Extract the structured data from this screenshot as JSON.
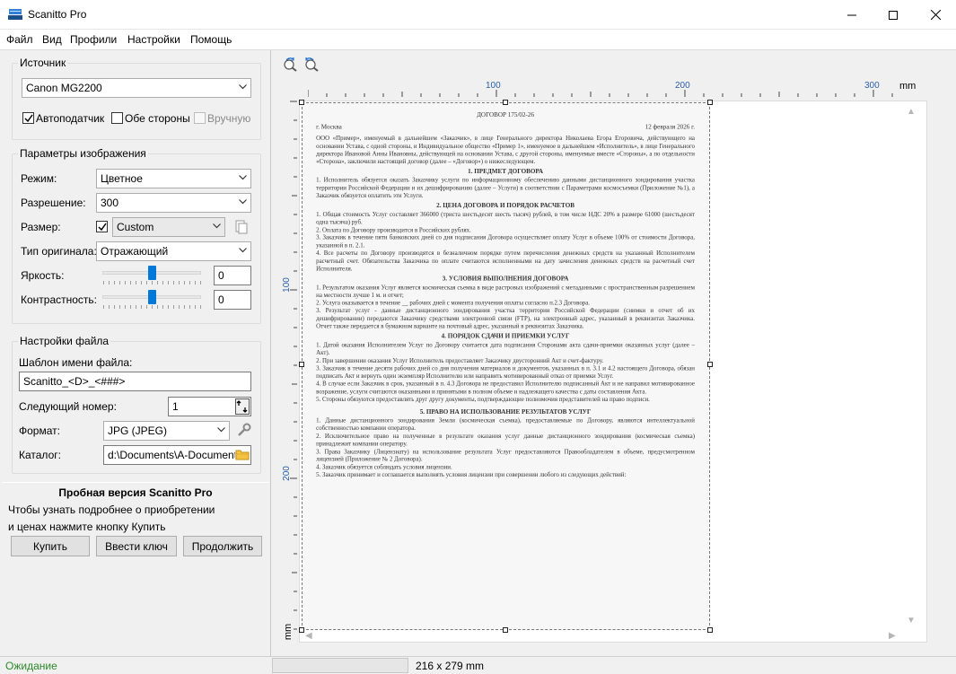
{
  "window": {
    "title": "Scanitto Pro",
    "min_label": "—",
    "max_label": "☐",
    "close_label": "✕"
  },
  "menu": [
    "Файл",
    "Вид",
    "Профили",
    "Настройки",
    "Помощь"
  ],
  "source": {
    "group_title": "Источник",
    "device": "Canon MG2200",
    "adf_label": "Автоподатчик",
    "adf_checked": true,
    "duplex_label": "Обе стороны",
    "duplex_checked": false,
    "manual_label": "Вручную",
    "manual_checked": false
  },
  "image_params": {
    "group_title": "Параметры изображения",
    "mode_label": "Режим:",
    "mode_value": "Цветное",
    "resolution_label": "Разрешение:",
    "resolution_value": "300",
    "size_label": "Размер:",
    "size_checked": true,
    "size_value": "Custom",
    "original_label": "Тип оригинала:",
    "original_value": "Отражающий",
    "brightness_label": "Яркость:",
    "brightness_value": "0",
    "contrast_label": "Контрастность:",
    "contrast_value": "0"
  },
  "file_settings": {
    "group_title": "Настройки файла",
    "template_label": "Шаблон имени файла:",
    "template_value": "Scanitto_<D>_<###>",
    "next_label": "Следующий номер:",
    "next_value": "1",
    "format_label": "Формат:",
    "format_value": "JPG (JPEG)",
    "folder_label": "Каталог:",
    "folder_value": "d:\\Documents\\A-Documents"
  },
  "trial": {
    "title": "Пробная версия Scanitto Pro",
    "line1": "Чтобы узнать подробнее о приобретении",
    "line2": "и ценах нажмите кнопку Купить",
    "buy": "Купить",
    "enter_key": "Ввести ключ",
    "continue": "Продолжить"
  },
  "ruler": {
    "unit": "mm",
    "top_ticks": [
      "100",
      "200",
      "300"
    ],
    "left_ticks": [
      "100",
      "200"
    ],
    "left_unit": "mm"
  },
  "status": {
    "state": "Ожидание",
    "state_color": "#2a8a2a",
    "size": "216 x 279 mm"
  },
  "document": {
    "title": "ДОГОВОР 175/02-26",
    "city": "г. Москва",
    "date": "12 февраля 2026 г.",
    "intro": "ООО «Пример», именуемый в дальнейшем «Заказчик», в лице Генерального директора Николаева Егора Егоровича, действующего на основании Устава, с одной стороны, и Индивидуальное общество «Пример 1», именуемое в дальнейшем «Исполнитель», в лице Генерального директора Ивановой Анны Ивановны, действующей на основании Устава, с другой стороны, именуемые вместе «Стороны», а по отдельности «Сторона», заключили настоящий договор (далее – «Договор») о нижеследующем.",
    "s1": "1. ПРЕДМЕТ ДОГОВОРА",
    "s1_1": "1. Исполнитель обязуется оказать Заказчику услуги по информационному обеспечению данными дистанционного зондирования участка территории Российской Федерации и их дешифрированию (далее – Услуги) в соответствии с Параметрами космосъемки (Приложение №1), а Заказчик обязуется оплатить эти Услуги.",
    "s2": "2. ЦЕНА ДОГОВОРА И ПОРЯДОК РАСЧЕТОВ",
    "s2_1": "1. Общая стоимость Услуг составляет 366000 (триста шестьдесят шесть тысяч) рублей, в том числе НДС 20% в размере 61000 (шестьдесят одна тысяча) руб.",
    "s2_2": "2. Оплата по Договору производится в Российских рублях.",
    "s2_3": "3. Заказчик в течение пяти банковских дней со дня подписания Договора осуществляет оплату Услуг в объеме 100% от стоимости Договора, указанной в п. 2.1.",
    "s2_4": "4. Все расчеты по Договору производятся в безналичном порядке путем перечисления денежных средств на указанный Исполнителем расчетный счет. Обязательства Заказчика по оплате считаются исполненными на дату зачисления денежных средств на расчетный счет Исполнителя.",
    "s3": "3. УСЛОВИЯ ВЫПОЛНЕНИЯ ДОГОВОРА",
    "s3_1": "1. Результатом оказания Услуг является космическая съемка в виде растровых изображений с метаданными с пространственным разрешением на местности лучше 1 м. и отчет;",
    "s3_2": "2. Услуга оказывается в течение __ рабочих дней с момента получения оплаты согласно п.2.3 Договора.",
    "s3_3": "3. Результат услуг - данные дистанционного зондирования участка территории Российской Федерации (снимки и отчет об их дешифрировании) передаются Заказчику средствами электронной связи (FTP), на электронный адрес, указанный в реквизитах Заказчика. Отчет также передается в бумажном варианте на почтовый адрес, указанный в реквизитах Заказчика.",
    "s4": "4. ПОРЯДОК СДАЧИ И ПРИЕМКИ УСЛУГ",
    "s4_1": "1. Датой оказания Исполнителем Услуг по Договору считается дата подписания Сторонами акта сдачи-приемки оказанных услуг (далее – Акт).",
    "s4_2": "2. При завершении оказания Услуг Исполнитель предоставляет Заказчику двусторонний Акт и счет-фактуру.",
    "s4_3": "3. Заказчик в течение десяти рабочих дней со дня получения материалов и документов, указанных в п. 3.1 и 4.2 настоящего Договора, обязан подписать Акт и вернуть один экземпляр Исполнителю или направить мотивированный отказ от приемки Услуг.",
    "s4_4": "4. В случае если Заказчик в срок, указанный в п. 4.3 Договора не предоставил Исполнителю подписанный Акт и не направил мотивированное возражение, услуги считаются оказанными и принятыми в полном объеме и надлежащего качества с даты составления Акта.",
    "s4_5": "5. Стороны обязуются предоставлять друг другу документы, подтверждающие полномочия представителей на право подписи.",
    "s5": "5. ПРАВО НА ИСПОЛЬЗОВАНИЕ РЕЗУЛЬТАТОВ УСЛУГ",
    "s5_1": "1. Данные дистанционного зондирования Земли (космическая съемка), предоставляемые по Договору, являются интеллектуальной собственностью компании оператора.",
    "s5_2": "2. Исключительное право на полученные в результате оказания услуг данные дистанционного зондирования (космическая съемка) принадлежит компании оператору.",
    "s5_3": "3. Права Заказчику (Лицензиату) на использование результата Услуг предоставляются Правообладателем в объеме, предусмотренном лицензией (Приложение № 2 Договора).",
    "s5_4": "4. Заказчик обязуется соблюдать условия лицензии.",
    "s5_5": "5. Заказчик принимает и соглашается выполнять условия лицензии при совершении любого из следующих действий:"
  }
}
